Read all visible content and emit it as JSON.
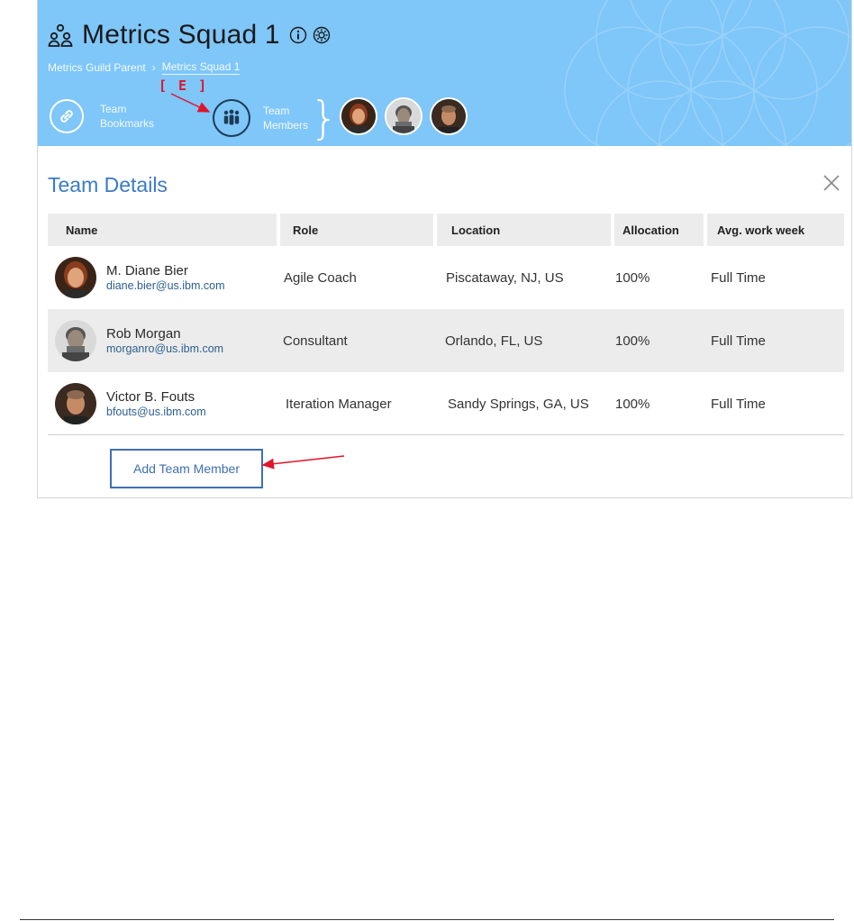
{
  "header": {
    "title": "Metrics Squad 1",
    "breadcrumb": {
      "parent": "Metrics Guild Parent",
      "current": "Metrics Squad 1"
    },
    "bookmarks_label_line1": "Team",
    "bookmarks_label_line2": "Bookmarks",
    "members_label_line1": "Team",
    "members_label_line2": "Members",
    "annotation": "[ E ]",
    "background_color": "#7fc6f9"
  },
  "details": {
    "title": "Team Details",
    "columns": [
      "Name",
      "Role",
      "Location",
      "Allocation",
      "Avg. work week"
    ],
    "rows": [
      {
        "name": "M. Diane Bier",
        "email": "diane.bier@us.ibm.com",
        "role": "Agile Coach",
        "location": "Piscataway, NJ, US",
        "allocation": "100%",
        "work_week": "Full Time"
      },
      {
        "name": "Rob Morgan",
        "email": "morganro@us.ibm.com",
        "role": "Consultant",
        "location": "Orlando, FL, US",
        "allocation": "100%",
        "work_week": "Full Time"
      },
      {
        "name": "Victor B. Fouts",
        "email": "bfouts@us.ibm.com",
        "role": "Iteration Manager",
        "location": "Sandy Springs, GA, US",
        "allocation": "100%",
        "work_week": "Full Time"
      }
    ],
    "add_button": "Add Team Member"
  },
  "icons": {
    "team": "team-icon",
    "info": "info-icon",
    "settings": "settings-icon",
    "bookmarks": "link-icon",
    "members": "people-icon",
    "close": "close-icon"
  },
  "colors": {
    "accent": "#3a7bc8",
    "annotation": "#e0142a",
    "row_alt": "#ececec"
  }
}
